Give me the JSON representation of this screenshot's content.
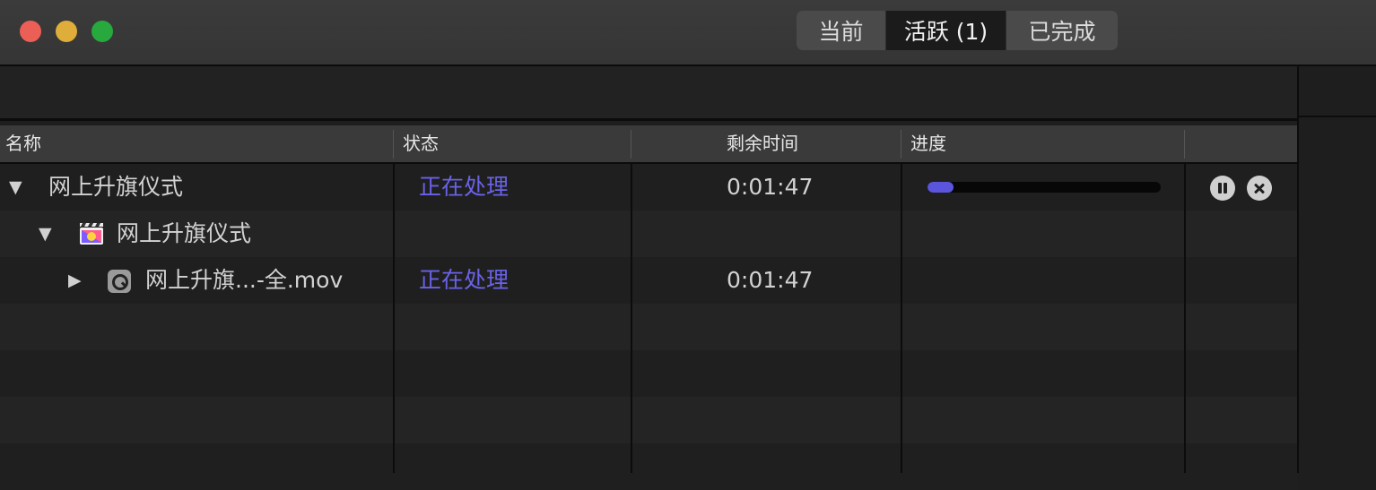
{
  "window": {
    "tabs": [
      {
        "label": "当前",
        "active": false
      },
      {
        "label": "活跃 (1)",
        "active": true
      },
      {
        "label": "已完成",
        "active": false
      }
    ]
  },
  "table": {
    "columns": [
      "名称",
      "状态",
      "剩余时间",
      "进度"
    ],
    "rows": [
      {
        "name": "网上升旗仪式",
        "status": "正在处理",
        "time_remaining": "0:01:47",
        "progress": 0.11,
        "expanded": true,
        "icon": "none"
      },
      {
        "name": "网上升旗仪式",
        "status": "",
        "time_remaining": "",
        "expanded": true,
        "icon": "final-cut-pro-icon"
      },
      {
        "name": "网上升旗...-全.mov",
        "status": "正在处理",
        "time_remaining": "0:01:47",
        "expanded": false,
        "icon": "quicktime-movie-icon"
      }
    ]
  },
  "colors": {
    "status": "#6a62e8",
    "progress_fill": "#5b55dd",
    "close": "#ec5f56",
    "minimize": "#dfad3a",
    "zoom": "#27a93d"
  }
}
